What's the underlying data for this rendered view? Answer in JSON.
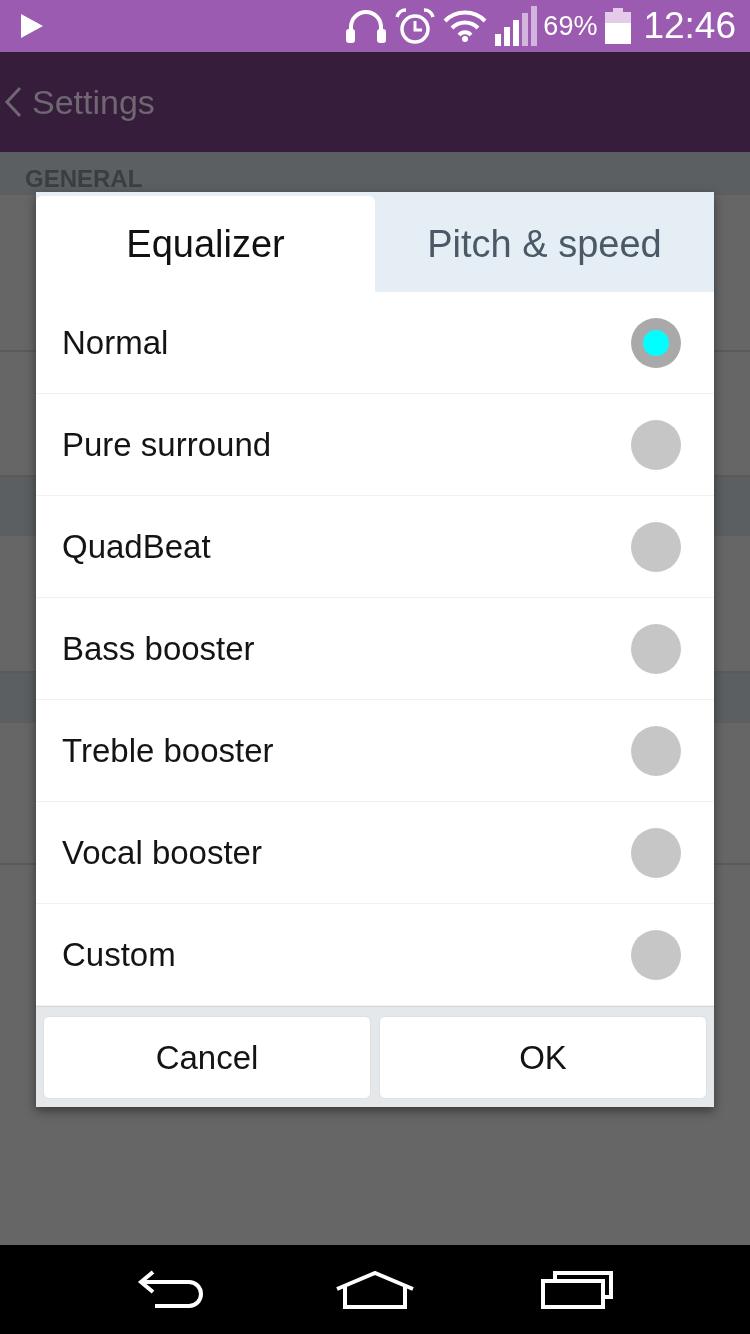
{
  "status_bar": {
    "battery_text": "69%",
    "time": "12:46"
  },
  "header": {
    "title": "Settings"
  },
  "background": {
    "section_header": "GENERAL"
  },
  "dialog": {
    "tabs": [
      {
        "label": "Equalizer",
        "selected": true
      },
      {
        "label": "Pitch & speed",
        "selected": false
      }
    ],
    "options": [
      {
        "label": "Normal",
        "selected": true
      },
      {
        "label": "Pure surround",
        "selected": false
      },
      {
        "label": "QuadBeat",
        "selected": false
      },
      {
        "label": "Bass booster",
        "selected": false
      },
      {
        "label": "Treble booster",
        "selected": false
      },
      {
        "label": "Vocal booster",
        "selected": false
      },
      {
        "label": "Custom",
        "selected": false
      }
    ],
    "buttons": [
      "Cancel",
      "OK"
    ]
  }
}
